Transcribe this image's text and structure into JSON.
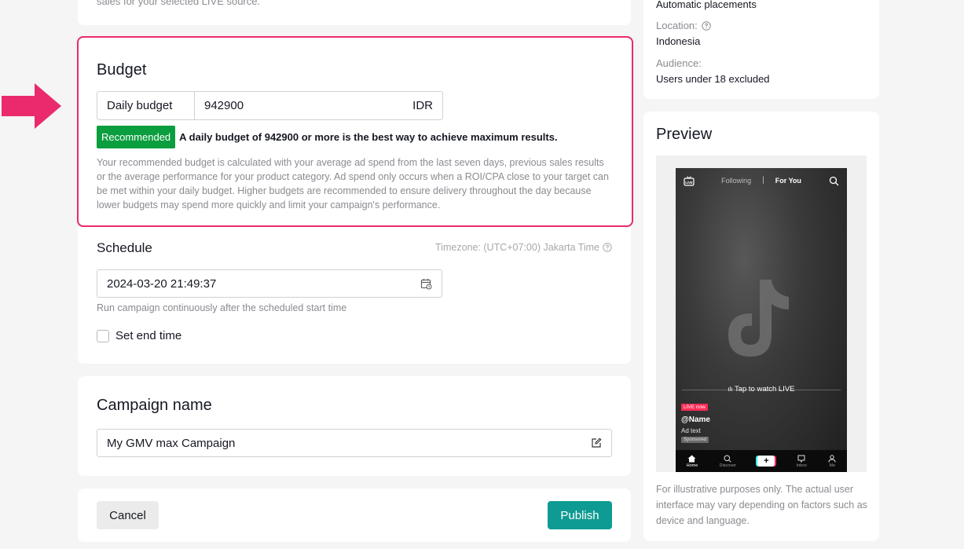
{
  "top_card": {
    "cut_text": "sales for your selected LIVE source."
  },
  "budget": {
    "title": "Budget",
    "input_label": "Daily budget",
    "input_value": "942900",
    "currency": "IDR",
    "recommended_badge": "Recommended",
    "recommended_text": "A daily budget of 942900 or more is the best way to achieve maximum results.",
    "description": "Your recommended budget is calculated with your average ad spend from the last seven days, previous sales results or the average performance for your product category. Ad spend only occurs when a ROI/CPA close to your target can be met within your daily budget. Higher budgets are recommended to ensure delivery throughout the day because lower budgets may spend more quickly and limit your campaign's performance."
  },
  "schedule": {
    "title": "Schedule",
    "timezone": "Timezone: (UTC+07:00) Jakarta Time",
    "date_value": "2024-03-20 21:49:37",
    "hint": "Run campaign continuously after the scheduled start time",
    "end_time_label": "Set end time",
    "end_time_checked": false
  },
  "campaign_name": {
    "title": "Campaign name",
    "value": "My GMV max Campaign"
  },
  "actions": {
    "cancel": "Cancel",
    "publish": "Publish"
  },
  "summary": {
    "placements": "Automatic placements",
    "location_label": "Location:",
    "location_value": "Indonesia",
    "audience_label": "Audience:",
    "audience_value": "Users under 18 excluded"
  },
  "preview": {
    "title": "Preview",
    "tab_following": "Following",
    "tab_for_you": "For You",
    "tap_watch": "Tap to watch LIVE",
    "live_badge": "LIVE now",
    "account_name": "@Name",
    "ad_text": "Ad text",
    "sponsored": "Sponsored",
    "nav": {
      "home": "Home",
      "discover": "Discover",
      "inbox": "Inbox",
      "me": "Me"
    },
    "note": "For illustrative purposes only. The actual user interface may vary depending on factors such as device and language."
  },
  "colors": {
    "highlight": "#ea2a6c",
    "recommended": "#0b9e3e",
    "publish": "#0e9b93",
    "arrow": "#ea2a6c"
  }
}
